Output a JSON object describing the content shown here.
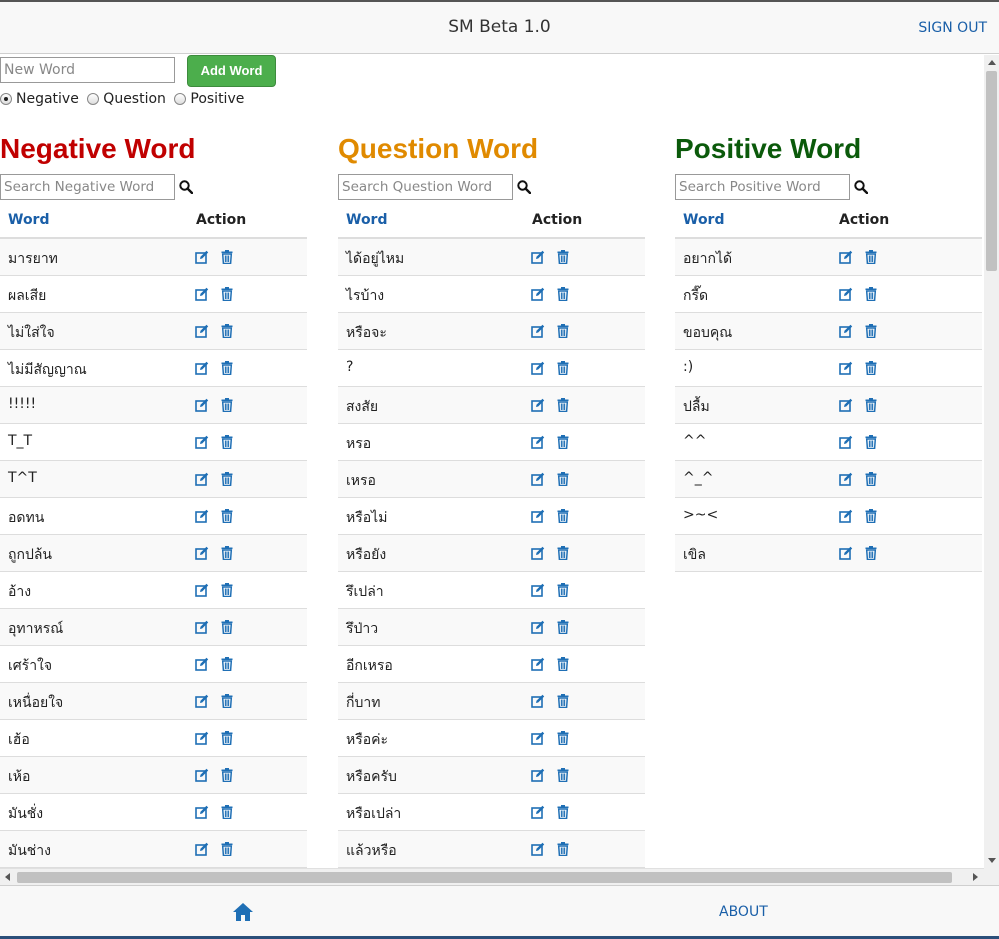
{
  "header": {
    "title": "SM Beta 1.0",
    "sign_out": "SIGN OUT"
  },
  "add_form": {
    "placeholder": "New Word",
    "button": "Add Word",
    "radios": [
      {
        "label": "Negative",
        "checked": true
      },
      {
        "label": "Question",
        "checked": false
      },
      {
        "label": "Positive",
        "checked": false
      }
    ]
  },
  "colors": {
    "negative": "#c00000",
    "question": "#e08a00",
    "positive": "#0b5a0b",
    "link": "#1a5fa8",
    "icon": "#1f6fb5",
    "button": "#4cae4c"
  },
  "columns": [
    {
      "key": "negative",
      "title": "Negative Word",
      "search_placeholder": "Search Negative Word",
      "header_word": "Word",
      "header_action": "Action",
      "words": [
        "มารยาท",
        "ผลเสีย",
        "ไม่ใส่ใจ",
        "ไม่มีสัญญาณ",
        "!!!!!",
        "T_T",
        "T^T",
        "อดทน",
        "ถูกปล้น",
        "อ้าง",
        "อุทาหรณ์",
        "เศร้าใจ",
        "เหนื่อยใจ",
        "เฮ้อ",
        "เห้อ",
        "มันชั่ง",
        "มันช่าง"
      ]
    },
    {
      "key": "question",
      "title": "Question Word",
      "search_placeholder": "Search Question Word",
      "header_word": "Word",
      "header_action": "Action",
      "words": [
        "ได้อยู่ไหม",
        "ไรบ้าง",
        "หรือจะ",
        "?",
        "สงสัย",
        "หรอ",
        "เหรอ",
        "หรือไม่",
        "หรือยัง",
        "รึเปล่า",
        "รึป่าว",
        "อีกเหรอ",
        "กี่บาท",
        "หรือค่ะ",
        "หรือครับ",
        "หรือเปล่า",
        "แล้วหรือ"
      ]
    },
    {
      "key": "positive",
      "title": "Positive Word",
      "search_placeholder": "Search Positive Word",
      "header_word": "Word",
      "header_action": "Action",
      "words": [
        "อยากได้",
        "กรี๊ด",
        "ขอบคุณ",
        ":)",
        "ปลื้ม",
        "^^",
        "^_^",
        ">~<",
        "เขิล"
      ]
    }
  ],
  "footer": {
    "home_icon": "home-icon",
    "about": "ABOUT"
  }
}
